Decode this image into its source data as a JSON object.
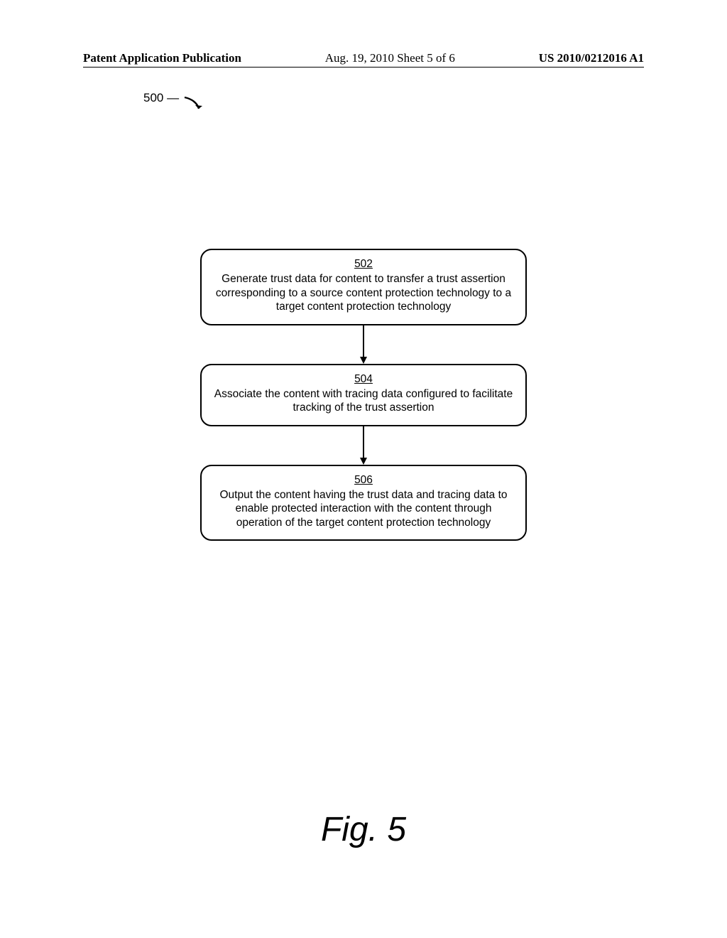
{
  "header": {
    "left": "Patent Application Publication",
    "center": "Aug. 19, 2010   Sheet 5 of 6",
    "right": "US 2010/0212016 A1"
  },
  "ref_label": "500",
  "flow": {
    "box1": {
      "num": "502",
      "text": "Generate trust data for content to transfer a trust assertion corresponding to a source content protection technology to a target content protection technology"
    },
    "box2": {
      "num": "504",
      "text": "Associate the content with tracing data configured to facilitate tracking of the trust assertion"
    },
    "box3": {
      "num": "506",
      "text": "Output the content having the trust data and tracing data to enable protected interaction with the content through operation of the target content protection technology"
    }
  },
  "figure_label": "Fig. 5",
  "chart_data": {
    "type": "flowchart",
    "title": "Fig. 5",
    "reference_numeral": "500",
    "nodes": [
      {
        "id": "502",
        "text": "Generate trust data for content to transfer a trust assertion corresponding to a source content protection technology to a target content protection technology"
      },
      {
        "id": "504",
        "text": "Associate the content with tracing data configured to facilitate tracking of the trust assertion"
      },
      {
        "id": "506",
        "text": "Output the content having the trust data and tracing data to enable protected interaction with the content through operation of the target content protection technology"
      }
    ],
    "edges": [
      {
        "from": "502",
        "to": "504"
      },
      {
        "from": "504",
        "to": "506"
      }
    ]
  }
}
